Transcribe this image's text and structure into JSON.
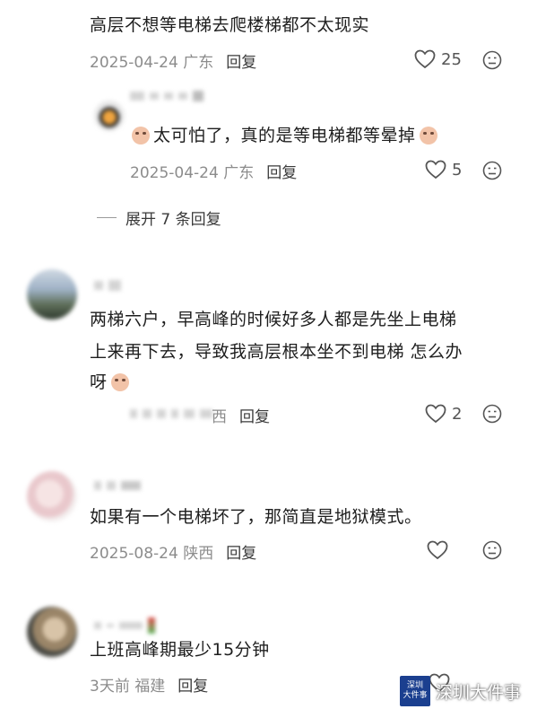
{
  "comments": [
    {
      "text": "高层不想等电梯去爬楼梯都不太现实",
      "meta": "2025-04-24 广东",
      "reply": "回复",
      "likes": "25"
    },
    {
      "text": "太可怕了，真的是等电梯都等晕掉",
      "meta": "2025-04-24 广东",
      "reply": "回复",
      "likes": "5"
    },
    {
      "expand": "展开 7 条回复"
    },
    {
      "lines": [
        "两梯六户，早高峰的时候好多人都是先坐上电梯",
        "上来再下去，导致我高层根本坐不到电梯 怎么办",
        "呀"
      ],
      "meta_suffix": "西",
      "reply": "回复",
      "likes": "2"
    },
    {
      "text": "如果有一个电梯坏了，那简直是地狱模式。",
      "meta": "2025-08-24 陕西",
      "reply": "回复",
      "likes": ""
    },
    {
      "text": "上班高峰期最少15分钟",
      "meta": "3天前 福建",
      "reply": "回复",
      "likes": ""
    }
  ],
  "watermark": {
    "badge_top": "深圳",
    "badge_bottom": "大件事",
    "label": "深圳大件事"
  },
  "icons": {
    "like": "heart-outline-icon",
    "dislike": "sad-face-icon"
  }
}
